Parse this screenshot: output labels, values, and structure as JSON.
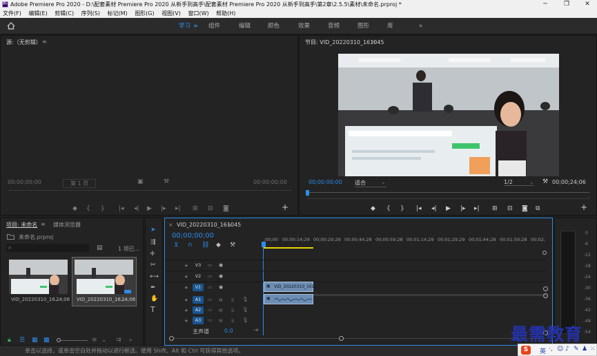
{
  "window": {
    "title": "Adobe Premiere Pro 2020 - D:\\配套素材 Premiere Pro 2020 从新手到高手\\配套素材 Premiere Pro 2020 从新手到高手\\第2章\\2.5.5\\素材\\未命名.prproj *",
    "logo": "Pr"
  },
  "menu": [
    "文件(F)",
    "编辑(E)",
    "剪辑(C)",
    "序列(S)",
    "标记(M)",
    "图形(G)",
    "视图(V)",
    "窗口(W)",
    "帮助(H)"
  ],
  "workspaces": {
    "items": [
      "学习",
      "组件",
      "编辑",
      "颜色",
      "效果",
      "音频",
      "图形",
      "库"
    ],
    "active": "学习",
    "more": "»"
  },
  "source_monitor": {
    "title": "源:（无剪辑）",
    "timecode_left": "00;00;00;00",
    "page": "第 1 页",
    "timecode_right": "00;00;00;00"
  },
  "program_monitor": {
    "title": "节目: VID_20220310_161045",
    "timecode_left": "00;00;00;00",
    "fit": "适合",
    "resolution": "1/2",
    "timecode_right": "00;00;24;06"
  },
  "project": {
    "tabs": [
      "项目: 未命名",
      "媒体浏览器"
    ],
    "file": "未命名.prproj",
    "item_count": "1 项已...",
    "clips": [
      {
        "name": "VID_20220310_16...",
        "duration": "24;06"
      },
      {
        "name": "VID_20220310_16...",
        "duration": "24;06"
      }
    ]
  },
  "timeline": {
    "tab": "VID_20220310_161045",
    "timecode": "00;00;00;00",
    "ruler": [
      ";00;00",
      "00;00;14;29",
      "00;00;29;29",
      "00;00;44;28",
      "00;00;59;28",
      "00;01;14;29",
      "00;01;29;29",
      "00;01;44;28",
      "00;01;59;28",
      "00;02;"
    ],
    "video_tracks": [
      "V3",
      "V2",
      "V1"
    ],
    "audio_tracks": [
      "A1",
      "A2",
      "A3"
    ],
    "mute": "M",
    "solo": "S",
    "master": "主声道",
    "master_value": "0.0",
    "clip_name": "VID_20220310_1610"
  },
  "meters": {
    "scale": [
      "0",
      "-6",
      "-12",
      "-18",
      "-24",
      "-30",
      "-36",
      "-42",
      "-48",
      "-54"
    ]
  },
  "status": "单击以选择，或单击空白处并拖动以进行框选。使用 Shift、Alt 和 Ctrl 可获得其他选项。",
  "watermark": "最需教育",
  "ime": {
    "lang": "英"
  }
}
